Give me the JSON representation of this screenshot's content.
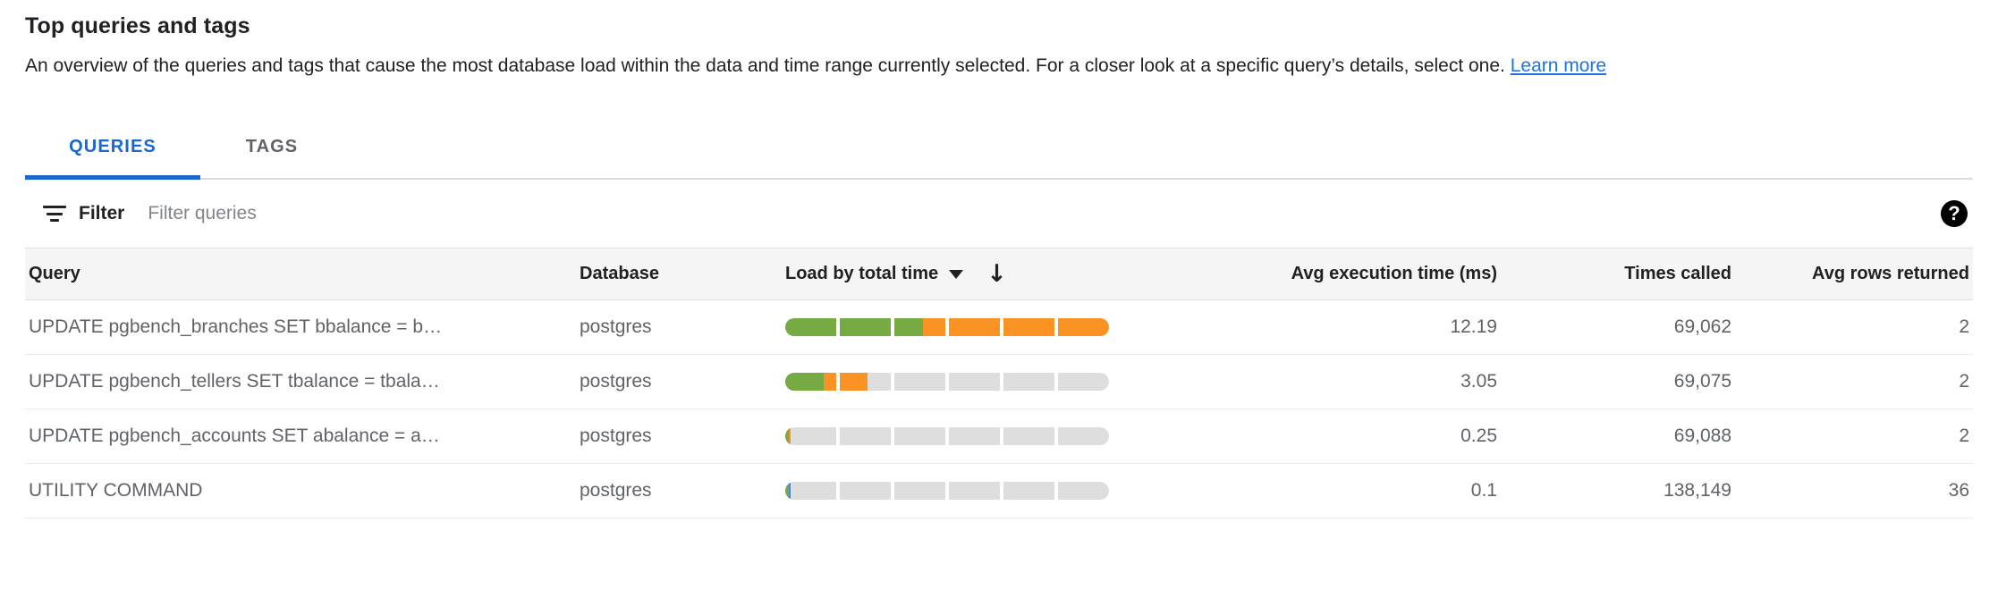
{
  "panel": {
    "title": "Top queries and tags",
    "description_before_link": "An overview of the queries and tags that cause the most database load within the data and time range currently selected. For a closer look at a specific query’s details, select one. ",
    "learn_more_label": "Learn more"
  },
  "tabs": [
    {
      "label": "QUERIES",
      "active": true
    },
    {
      "label": "TAGS",
      "active": false
    }
  ],
  "toolbar": {
    "filter_label": "Filter",
    "filter_placeholder": "Filter queries",
    "filter_value": "",
    "filter_icon": "filter-icon",
    "help_icon": "help-icon",
    "help_glyph": "?"
  },
  "table": {
    "columns": [
      {
        "key": "query",
        "label": "Query",
        "align": "left"
      },
      {
        "key": "database",
        "label": "Database",
        "align": "left"
      },
      {
        "key": "load",
        "label": "Load by total time",
        "align": "left",
        "sorted": true,
        "sort_direction": "desc",
        "caret_glyph": "▼",
        "arrow_glyph": "↓"
      },
      {
        "key": "avg_execution_time",
        "label": "Avg execution time (ms)",
        "align": "right"
      },
      {
        "key": "times_called",
        "label": "Times called",
        "align": "right"
      },
      {
        "key": "avg_rows_returned",
        "label": "Avg rows returned",
        "align": "right"
      }
    ],
    "rows": [
      {
        "query": "UPDATE pgbench_branches SET bbalance = b…",
        "database": "postgres",
        "avg_execution_time": "12.19",
        "times_called": "69,062",
        "avg_rows_returned": "2",
        "load_segments": [
          {
            "color": "#76aa43",
            "percent": 42.5
          },
          {
            "color": "#fb9224",
            "percent": 57.5
          }
        ]
      },
      {
        "query": "UPDATE pgbench_tellers SET tbalance = tbala…",
        "database": "postgres",
        "avg_execution_time": "3.05",
        "times_called": "69,075",
        "avg_rows_returned": "2",
        "load_segments": [
          {
            "color": "#76aa43",
            "percent": 11.8
          },
          {
            "color": "#fb9224",
            "percent": 13.5
          }
        ]
      },
      {
        "query": "UPDATE pgbench_accounts SET abalance = a…",
        "database": "postgres",
        "avg_execution_time": "0.25",
        "times_called": "69,088",
        "avg_rows_returned": "2",
        "load_segments": [
          {
            "color": "#76aa43",
            "percent": 1.1
          },
          {
            "color": "#fb9224",
            "percent": 0.5
          }
        ]
      },
      {
        "query": "UTILITY COMMAND",
        "database": "postgres",
        "avg_execution_time": "0.1",
        "times_called": "138,149",
        "avg_rows_returned": "36",
        "load_segments": [
          {
            "color": "#76aa43",
            "percent": 1.1
          },
          {
            "color": "#4285f4",
            "percent": 0.5
          }
        ]
      }
    ],
    "load_bar": {
      "tick_count": 6,
      "track_color": "#dedede"
    }
  },
  "colors": {
    "accent": "#1967d2",
    "link": "#1a73e8",
    "green": "#76aa43",
    "orange": "#fb9224",
    "blue": "#4285f4",
    "header_bg": "#f5f5f5"
  }
}
